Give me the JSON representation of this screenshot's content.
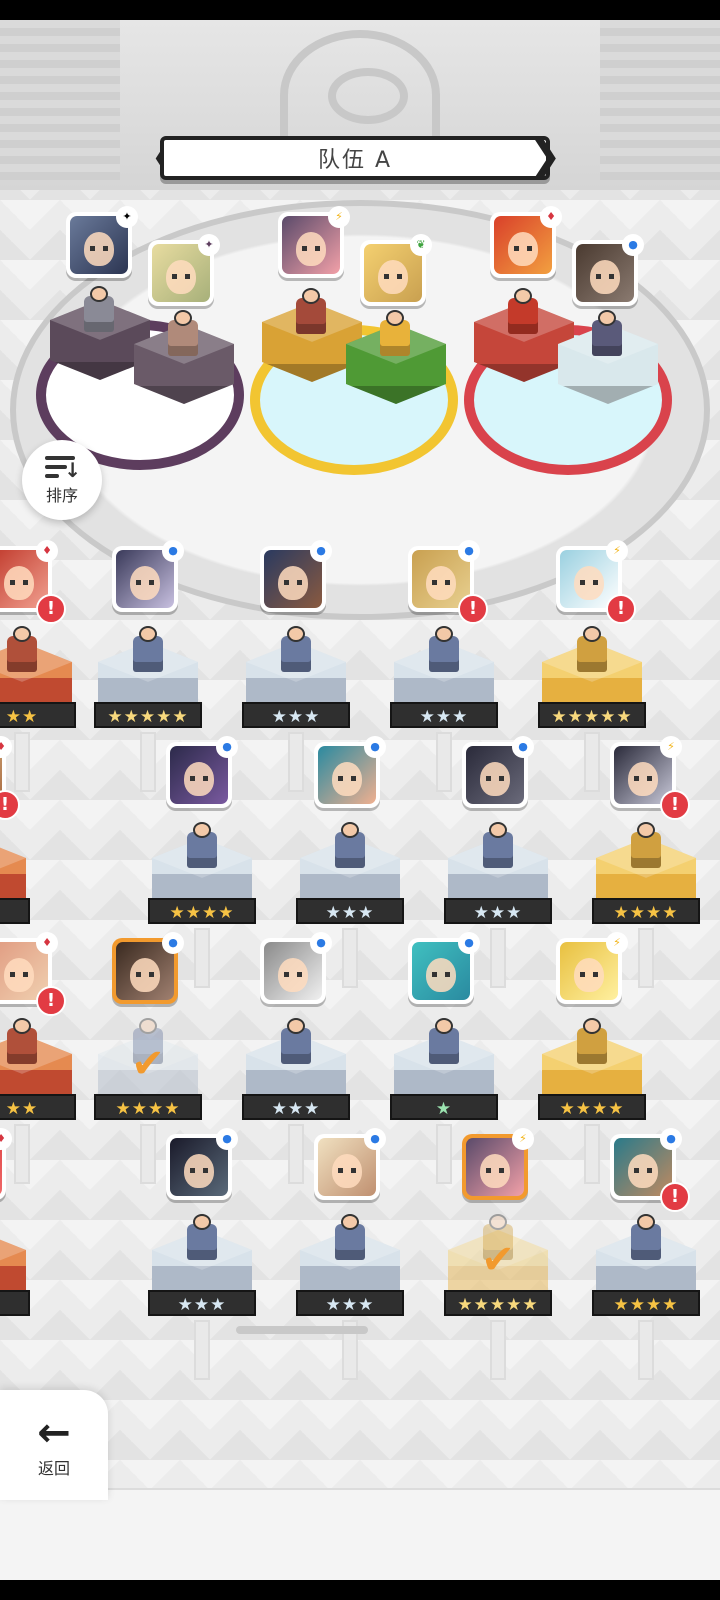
{
  "team": {
    "name": "队伍 A",
    "prev_arrow": "❮",
    "next_arrow": "❯"
  },
  "controls": {
    "sort_label": "排序",
    "back_label": "返回",
    "back_icon": "←"
  },
  "colors": {
    "dark_ring": "#5d3d5e",
    "light_ring": "#f2c531",
    "fire_ring": "#d9434c",
    "selected_border": "#f29a2e",
    "alert": "#e23b43"
  },
  "element_icons": {
    "water": "●",
    "fire": "♦",
    "light": "⚡",
    "dark": "✦",
    "earth": "❦"
  },
  "team_slots": [
    {
      "element": "dark",
      "icon": "dark-icon"
    },
    {
      "element": "dark",
      "icon": "dark-icon"
    },
    {
      "element": "light",
      "icon": "light-icon"
    },
    {
      "element": "earth",
      "icon": "earth-icon"
    },
    {
      "element": "fire",
      "icon": "fire-icon"
    },
    {
      "element": "water",
      "icon": "water-icon"
    }
  ],
  "roster": [
    {
      "stars": "★★",
      "element": "fire",
      "alert": "!"
    },
    {
      "stars": "★★★★★",
      "element": "water"
    },
    {
      "stars": "★★★",
      "element": "water"
    },
    {
      "stars": "★★★",
      "element": "water",
      "alert": "!"
    },
    {
      "stars": "★★★★★",
      "element": "light",
      "alert": "!"
    },
    {
      "stars": "★★★",
      "element": "fire",
      "alert": "!"
    },
    {
      "stars": "★★★★",
      "element": "water"
    },
    {
      "stars": "★★★",
      "element": "water"
    },
    {
      "stars": "★★★",
      "element": "water"
    },
    {
      "stars": "★★★★",
      "element": "light",
      "alert": "!"
    },
    {
      "stars": "★★",
      "element": "fire",
      "alert": "!"
    },
    {
      "stars": "★★★★",
      "element": "water",
      "selected": true,
      "check": "✔"
    },
    {
      "stars": "★★★",
      "element": "water"
    },
    {
      "stars": "★",
      "element": "water"
    },
    {
      "stars": "★★★★",
      "element": "light"
    },
    {
      "stars": "★",
      "element": "fire"
    },
    {
      "stars": "★★★",
      "element": "water"
    },
    {
      "stars": "★★★",
      "element": "water"
    },
    {
      "stars": "★★★★★",
      "element": "light",
      "selected": true,
      "check": "✔"
    },
    {
      "stars": "★★★★",
      "element": "water",
      "alert": "!"
    }
  ]
}
